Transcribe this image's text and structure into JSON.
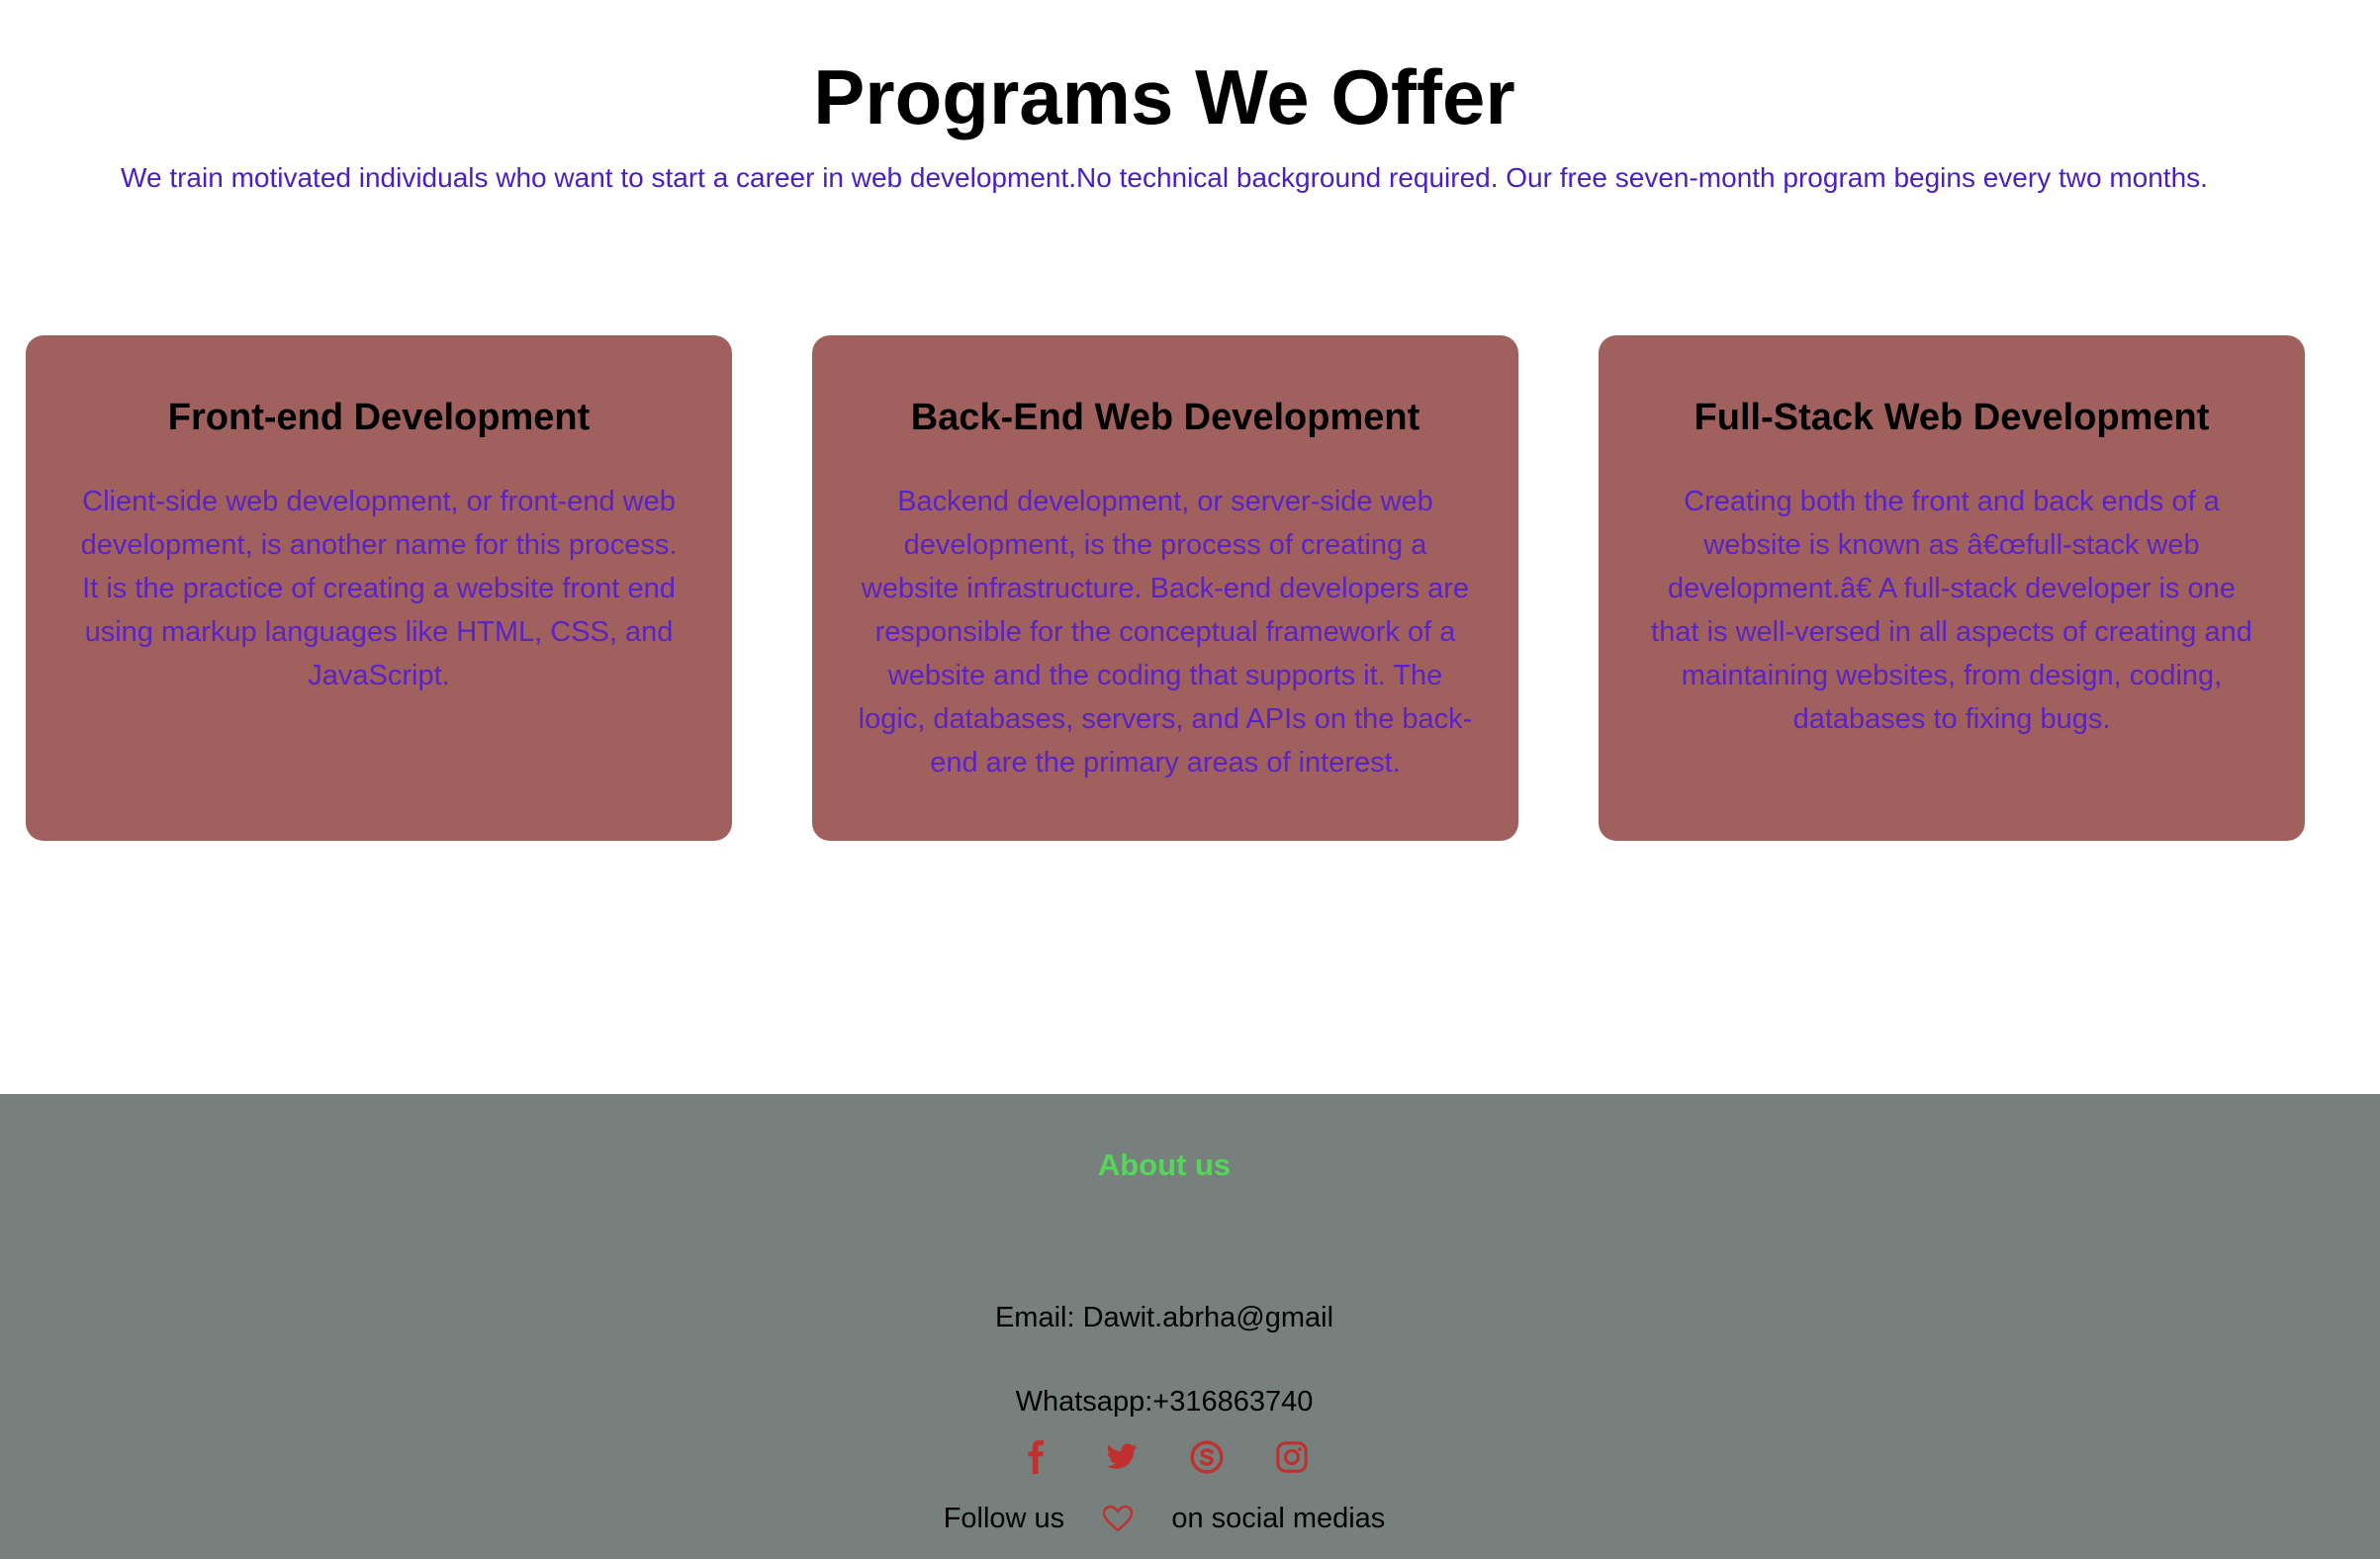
{
  "programs": {
    "title": "Programs We Offer",
    "intro": "We train motivated individuals who want to start a career in web development.No technical background required. Our free seven-month program begins every two months.",
    "cards": [
      {
        "title": "Front-end Development",
        "text": "Client-side web development, or front-end web development, is another name for this process. It is the practice of creating a website front end using markup languages like HTML, CSS, and JavaScript."
      },
      {
        "title": "Back-End Web Development",
        "text": "Backend development, or server-side web development, is the process of creating a website infrastructure. Back-end developers are responsible for the conceptual framework of a website and the coding that supports it. The logic, databases, servers, and APIs on the back-end are the primary areas of interest."
      },
      {
        "title": "Full-Stack Web Development",
        "text": "Creating both the front and back ends of a website is known as â€œfull-stack web development.â€ A full-stack developer is one that is well-versed in all aspects of creating and maintaining websites, from design, coding, databases to fixing bugs."
      }
    ]
  },
  "footer": {
    "title": "About us",
    "email": "Email: Dawit.abrha@gmail",
    "whatsapp": "Whatsapp:+316863740",
    "social_icons": [
      "facebook-icon",
      "twitter-icon",
      "skype-icon",
      "instagram-icon"
    ],
    "follow_prefix": "Follow us",
    "follow_icon": "heart-icon",
    "follow_suffix": "on social medias"
  },
  "colors": {
    "card_background": "#a0605e",
    "card_text": "#5a23c4",
    "intro_text": "#4a1fbf",
    "footer_background": "#77807d",
    "footer_title": "#55d65a",
    "social_icon": "#c0302e"
  }
}
